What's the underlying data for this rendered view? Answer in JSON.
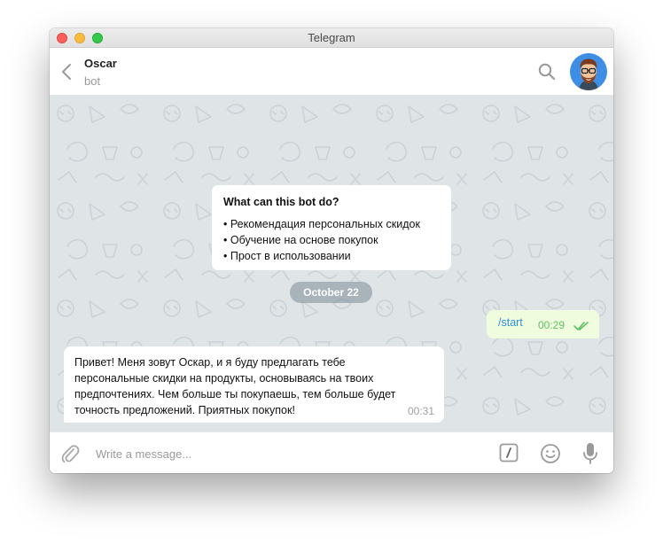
{
  "window": {
    "title": "Telegram"
  },
  "header": {
    "name": "Oscar",
    "status": "bot"
  },
  "bot_info": {
    "title": "What can this bot do?",
    "items": [
      "• Рекомендация персональных скидок",
      "• Обучение на основе покупок",
      "• Прост в использовании"
    ]
  },
  "date_divider": "October 22",
  "messages": [
    {
      "direction": "out",
      "text": "/start",
      "time": "00:29",
      "status": "read"
    },
    {
      "direction": "in",
      "text": "Привет! Меня зовут Оскар, и я буду предлагать тебе персональные скидки на продукты, основываясь на твоих предпочтениях. Чем больше ты покупаешь, тем больше будет точность предложений. Приятных покупок!",
      "time": "00:31"
    }
  ],
  "composer": {
    "placeholder": "Write a message..."
  },
  "colors": {
    "accent": "#2f8fd8",
    "outgoing_bubble": "#effdde",
    "read_ticks": "#5fbf64",
    "chat_background": "#dfe4e7",
    "avatar_bg": "#3e8ee6"
  },
  "icons": {
    "back": "chevron-left-icon",
    "search": "search-icon",
    "attach": "paperclip-icon",
    "commands": "slash-command-icon",
    "emoji": "smiley-icon",
    "voice": "microphone-icon",
    "read": "double-check-icon"
  }
}
